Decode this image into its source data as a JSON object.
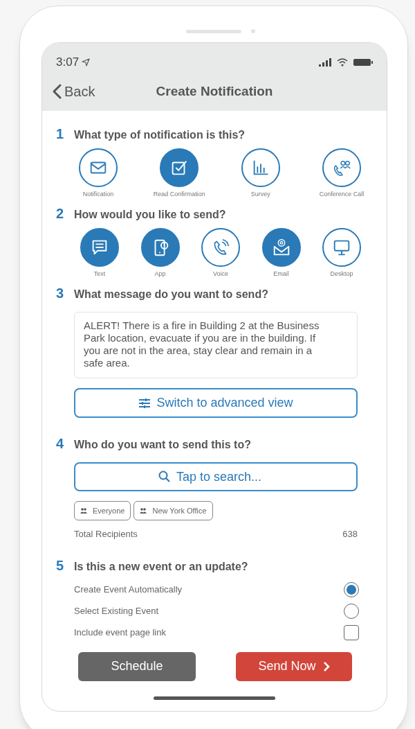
{
  "status_bar": {
    "time": "3:07"
  },
  "nav": {
    "back": "Back",
    "title": "Create Notification"
  },
  "notification_type": {
    "number": "1",
    "question": "What type of notification is this?",
    "options": [
      {
        "label": "Notification",
        "selected": false
      },
      {
        "label": "Read Confirmation",
        "selected": true
      },
      {
        "label": "Survey",
        "selected": false
      },
      {
        "label": "Conference Call",
        "selected": false
      }
    ]
  },
  "send_method": {
    "number": "2",
    "question": "How would you like to send?",
    "options": [
      {
        "label": "Text",
        "selected": true
      },
      {
        "label": "App",
        "selected": true
      },
      {
        "label": "Voice",
        "selected": false
      },
      {
        "label": "Email",
        "selected": true
      },
      {
        "label": "Desktop",
        "selected": false
      }
    ]
  },
  "message": {
    "number": "3",
    "question": "What message do you want to send?",
    "text": "ALERT! There is a fire in Building 2 at the Business Park location, evacuate if you are in the building. If you are not in the area, stay clear and remain in a safe area.",
    "advanced_button": "Switch to advanced view"
  },
  "recipients": {
    "number": "4",
    "question": "Who do you want to send this to?",
    "search_placeholder": "Tap to search...",
    "chips": [
      "Everyone",
      "New York Office"
    ],
    "total_label": "Total Recipients",
    "total_value": "638"
  },
  "event": {
    "number": "5",
    "question": "Is this a new event or an update?",
    "options": [
      {
        "label": "Create Event Automatically",
        "kind": "radio",
        "checked": true
      },
      {
        "label": "Select Existing Event",
        "kind": "radio",
        "checked": false
      },
      {
        "label": "Include event page link",
        "kind": "checkbox",
        "checked": false
      }
    ]
  },
  "buttons": {
    "schedule": "Schedule",
    "send": "Send Now"
  }
}
